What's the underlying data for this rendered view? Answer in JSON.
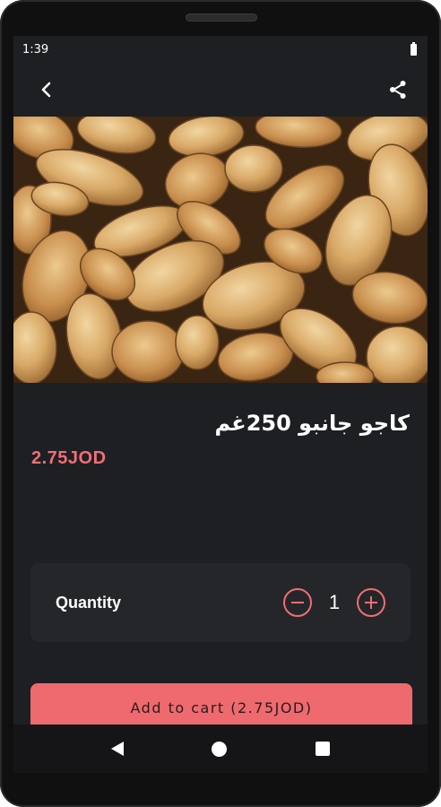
{
  "status_bar": {
    "time": "1:39",
    "battery_icon": "battery-full-icon"
  },
  "app_bar": {
    "back_icon": "chevron-left-icon",
    "share_icon": "share-icon"
  },
  "product": {
    "image": "cashew-nuts-photo",
    "title": "كاجو جانبو 250غم",
    "price": "2.75JOD"
  },
  "quantity": {
    "label": "Quantity",
    "value": "1",
    "decrement_icon": "minus-circle-icon",
    "increment_icon": "plus-circle-icon"
  },
  "cart": {
    "add_label": "Add to cart (2.75JOD)"
  },
  "nav_bar": {
    "back_icon": "triangle-back-icon",
    "home_icon": "circle-home-icon",
    "recents_icon": "square-recents-icon"
  },
  "colors": {
    "accent": "#ef6f74",
    "button": "#ee6a6f",
    "background": "#1e1f23",
    "card": "#252629"
  }
}
